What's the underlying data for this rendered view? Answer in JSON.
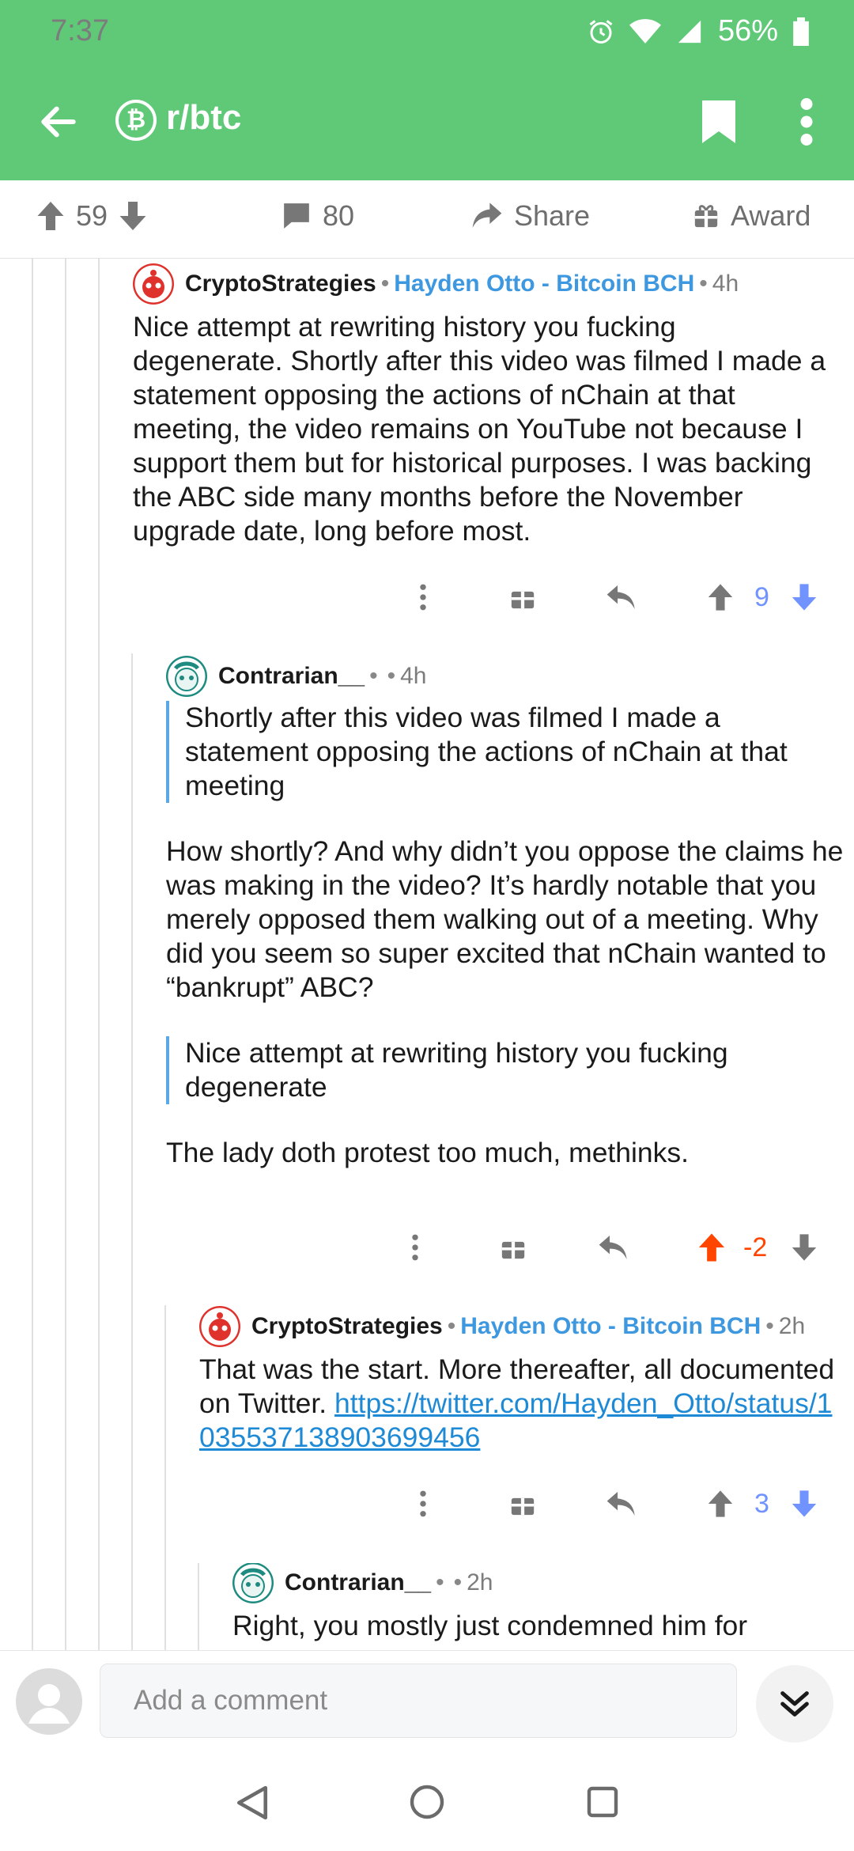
{
  "status_bar": {
    "time": "7:37",
    "battery": "56%"
  },
  "toolbar": {
    "subreddit": "r/btc",
    "sub_icon": "₿"
  },
  "post_actions": {
    "upvotes": "59",
    "comments": "80",
    "share": "Share",
    "award": "Award"
  },
  "comments": [
    {
      "author": "CryptoStrategies",
      "flair": "Hayden Otto - Bitcoin BCH",
      "time": "4h",
      "body": "Nice attempt at rewriting history you fucking degenerate. Shortly after this video was filmed I made a statement opposing the actions of nChain at that meeting, the video remains on YouTube not because I support them but for historical purposes. I was backing the ABC side many months before the November upgrade date, long before most.",
      "score": "9"
    },
    {
      "author": "Contrarian__",
      "time": "4h",
      "quote1": "Shortly after this video was filmed I made a statement opposing the actions of nChain at that meeting",
      "para1": "How shortly? And why didn’t you oppose the claims he was making in the video? It’s hardly notable that you merely opposed them walking out of a meeting. Why did you seem so super excited that nChain wanted to “bankrupt” ABC?",
      "quote2": "Nice attempt at rewriting history you fucking degenerate",
      "para2": "The lady doth protest too much, methinks.",
      "score": "-2"
    },
    {
      "author": "CryptoStrategies",
      "flair": "Hayden Otto - Bitcoin BCH",
      "time": "2h",
      "body": "That was the start. More thereafter, all documented on Twitter.",
      "link": "https://twitter.com/Hayden_Otto/status/1035537138903699456",
      "score": "3"
    },
    {
      "author": "Contrarian__",
      "time": "2h",
      "body": "Right, you mostly just condemned him for"
    }
  ],
  "composer": {
    "placeholder": "Add a comment"
  },
  "colors": {
    "brand_green": "#5fc977",
    "upvote_orange": "#ff4500",
    "downvote_blue": "#7193ff",
    "flair_blue": "#3e98e0"
  }
}
